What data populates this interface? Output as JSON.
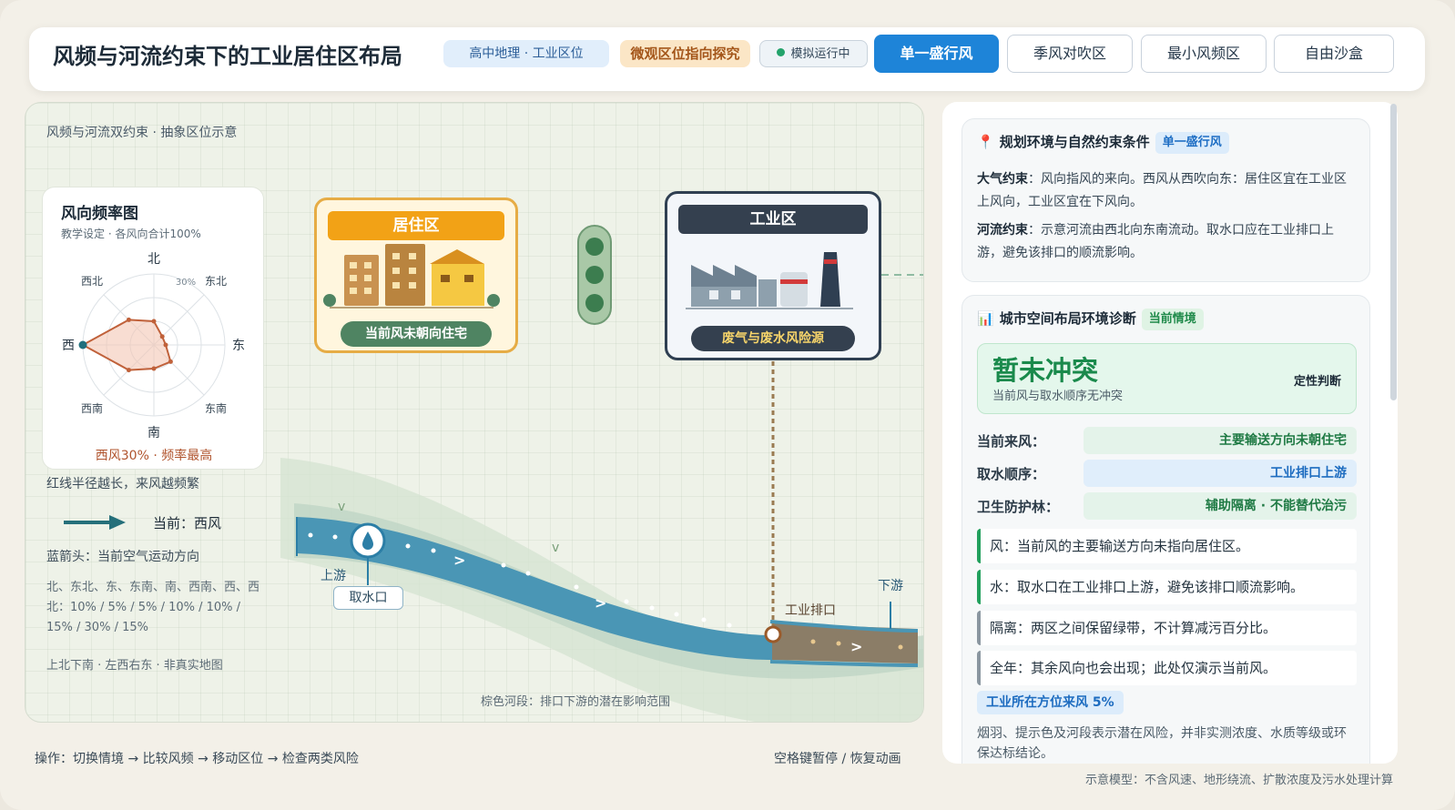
{
  "header": {
    "title": "风频与河流约束下的工业居住区布局",
    "chips": [
      "高中地理 · 工业区位",
      "微观区位指向探究"
    ],
    "status": "模拟运行中",
    "tabs": [
      "单一盛行风",
      "季风对吹区",
      "最小风频区",
      "自由沙盒"
    ],
    "active_tab": "单一盛行风"
  },
  "canvas": {
    "caption": "风频与河流双约束 · 抽象区位示意",
    "rose": {
      "title": "风向频率图",
      "subtitle": "教学设定 · 各风向合计100%",
      "directions": [
        "北",
        "东北",
        "东",
        "东南",
        "南",
        "西南",
        "西",
        "西北"
      ],
      "ring_label": "30%",
      "frequencies": [
        10,
        5,
        5,
        10,
        10,
        15,
        30,
        15
      ],
      "footer": "西风30% · 频率最高"
    },
    "rose_note": "红线半径越长，来风越频繁",
    "current_wind": "当前：西风",
    "arrow_note": "蓝箭头：当前空气运动方向",
    "freq_text": "北、东北、东、东南、南、西南、西、西北：10% / 5% / 5% / 10% / 10% / 15% / 30% / 15%",
    "orientation_note": "上北下南 · 左西右东 · 非真实地图",
    "residential": {
      "label": "居住区",
      "tag": "当前风未朝向住宅"
    },
    "industrial": {
      "label": "工业区",
      "tag": "废气与废水风险源"
    },
    "river": {
      "upstream": "上游",
      "downstream": "下游",
      "intake": "取水口",
      "outfall": "工业排口",
      "caption": "棕色河段：排口下游的潜在影响范围"
    },
    "colors": {
      "river": "#4a96b5",
      "polluted": "#8b7d67",
      "residential": "#f2a216",
      "industrial": "#34404f"
    }
  },
  "footer": {
    "ops": "操作：切换情境 → 比较风频 → 移动区位 → 检查两类风险",
    "pause": "空格键暂停 / 恢复动画",
    "model_note": "示意模型：不含风速、地形绕流、扩散浓度及污水处理计算"
  },
  "panel": {
    "env": {
      "title": "规划环境与自然约束条件",
      "badge": "单一盛行风",
      "atmo_label": "大气约束",
      "atmo_text": "：风向指风的来向。西风从西吹向东：居住区宜在工业区上风向，工业区宜在下风向。",
      "river_label": "河流约束",
      "river_text": "：示意河流由西北向东南流动。取水口应在工业排口上游，避免该排口的顺流影响。"
    },
    "diag": {
      "title": "城市空间布局环境诊断",
      "badge": "当前情境",
      "verdict": "暂未冲突",
      "verdict_sub": "当前风与取水顺序无冲突",
      "verdict_tag": "定性判断",
      "rows": [
        {
          "label": "当前来风：",
          "value": "主要输送方向未朝住宅"
        },
        {
          "label": "取水顺序：",
          "value": "工业排口上游"
        },
        {
          "label": "卫生防护林：",
          "value": "辅助隔离 · 不能替代治污"
        }
      ],
      "points": [
        "风：当前风的主要输送方向未指向居住区。",
        "水：取水口在工业排口上游，避免该排口顺流影响。",
        "隔离：两区之间保留绿带，不计算减污百分比。",
        "全年：其余风向也会出现；此处仅演示当前风。"
      ],
      "freq_chip": "工业所在方位来风 5%",
      "disclaimer": "烟羽、提示色及河段表示潜在风险，并非实测浓度、水质等级或环保达标结论。"
    }
  }
}
